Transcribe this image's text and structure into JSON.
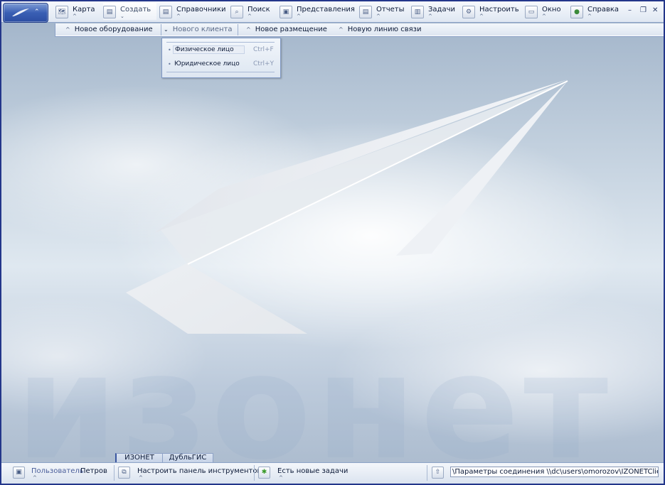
{
  "menubar": {
    "items": [
      {
        "label": "Карта",
        "icon": "map-icon",
        "glyph": "🗺"
      },
      {
        "label": "Создать",
        "icon": "create-icon",
        "glyph": "▤"
      },
      {
        "label": "Справочники",
        "icon": "reference-icon",
        "glyph": "▤"
      },
      {
        "label": "Поиск",
        "icon": "search-icon",
        "glyph": "⌕"
      },
      {
        "label": "Представления",
        "icon": "views-icon",
        "glyph": "▣"
      },
      {
        "label": "Отчеты",
        "icon": "reports-icon",
        "glyph": "▤"
      },
      {
        "label": "Задачи",
        "icon": "tasks-icon",
        "glyph": "▥"
      },
      {
        "label": "Настроить",
        "icon": "settings-icon",
        "glyph": "⚙"
      },
      {
        "label": "Окно",
        "icon": "window-icon",
        "glyph": "▭"
      },
      {
        "label": "Справка",
        "icon": "help-icon",
        "glyph": "●"
      }
    ]
  },
  "subbar": {
    "items": [
      {
        "label": "Новое оборудование"
      },
      {
        "label": "Нового клиента"
      },
      {
        "label": "Новое размещение"
      },
      {
        "label": "Новую линию связи"
      }
    ]
  },
  "dropdown": {
    "items": [
      {
        "label": "Физическое лицо",
        "shortcut": "Ctrl+F"
      },
      {
        "label": "Юридическое лицо",
        "shortcut": "Ctrl+Y"
      }
    ]
  },
  "watermark": "изонет",
  "tabs": [
    {
      "label": "ИЗОНЕТ"
    },
    {
      "label": "ДубльГИС"
    }
  ],
  "statusbar": {
    "user_caption": "Пользователь",
    "user_name": "Петров",
    "toolbar_setup": "Настроить панель инструментов",
    "new_tasks": "Есть новые задачи",
    "connection_path": "\\Параметры соединения \\\\dc\\users\\omorozov\\IZONETClient"
  },
  "colors": {
    "frame": "#23368a",
    "accent": "#3a5fb4",
    "bar": "#dfe7f2"
  }
}
